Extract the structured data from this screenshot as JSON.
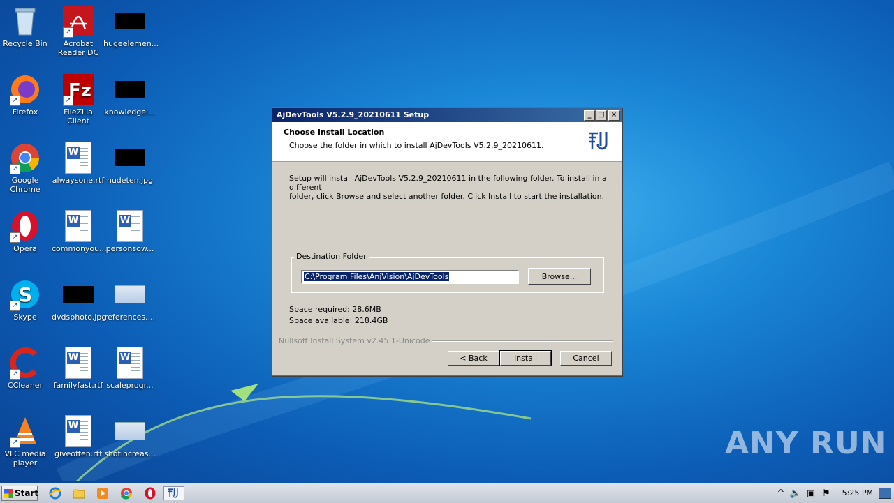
{
  "desktop": {
    "icons": [
      {
        "label": "Recycle Bin",
        "icon": "recycle-bin-icon"
      },
      {
        "label": "Acrobat Reader DC",
        "icon": "acrobat-icon"
      },
      {
        "label": "hugeelemen...",
        "icon": "black-thumbnail-icon"
      },
      {
        "label": "Firefox",
        "icon": "firefox-icon"
      },
      {
        "label": "FileZilla Client",
        "icon": "filezilla-icon"
      },
      {
        "label": "knowledgei...",
        "icon": "black-thumbnail-icon"
      },
      {
        "label": "Google Chrome",
        "icon": "chrome-icon"
      },
      {
        "label": "alwaysone.rtf",
        "icon": "word-doc-icon"
      },
      {
        "label": "nudeten.jpg",
        "icon": "black-thumbnail-icon"
      },
      {
        "label": "Opera",
        "icon": "opera-icon"
      },
      {
        "label": "commonyou...",
        "icon": "word-doc-icon"
      },
      {
        "label": "personsow...",
        "icon": "word-doc-icon"
      },
      {
        "label": "Skype",
        "icon": "skype-icon"
      },
      {
        "label": "dvdsphoto.jpg",
        "icon": "black-thumbnail-icon"
      },
      {
        "label": "references....",
        "icon": "blank-file-icon"
      },
      {
        "label": "CCleaner",
        "icon": "ccleaner-icon"
      },
      {
        "label": "familyfast.rtf",
        "icon": "word-doc-icon"
      },
      {
        "label": "scaleprogr...",
        "icon": "word-doc-icon"
      },
      {
        "label": "VLC media player",
        "icon": "vlc-icon"
      },
      {
        "label": "giveoften.rtf",
        "icon": "word-doc-icon"
      },
      {
        "label": "shotincreas...",
        "icon": "blank-file-icon"
      }
    ]
  },
  "dialog": {
    "title": "AjDevTools V5.2.9_20210611 Setup",
    "header_title": "Choose Install Location",
    "header_subtitle": "Choose the folder in which to install AjDevTools V5.2.9_20210611.",
    "body_line1": "Setup will install AjDevTools V5.2.9_20210611 in the following folder. To install in a different",
    "body_line2": "folder, click Browse and select another folder. Click Install to start the installation.",
    "group_label": "Destination Folder",
    "path_value": "C:\\Program Files\\AnjVision\\AjDevTools",
    "browse_label": "Browse...",
    "space_required": "Space required: 28.6MB",
    "space_available": "Space available: 218.4GB",
    "branding": "Nullsoft Install System v2.45.1-Unicode",
    "back_label": "< Back",
    "install_label": "Install",
    "cancel_label": "Cancel",
    "minimize_glyph": "_",
    "maximize_glyph": "□",
    "close_glyph": "×"
  },
  "taskbar": {
    "start_label": "Start",
    "clock": "5:25 PM",
    "pinned": [
      "ie-icon",
      "explorer-icon",
      "media-player-icon",
      "chrome-icon",
      "opera-icon",
      "ajdevtools-setup-icon"
    ]
  },
  "watermark": "ANY RUN"
}
